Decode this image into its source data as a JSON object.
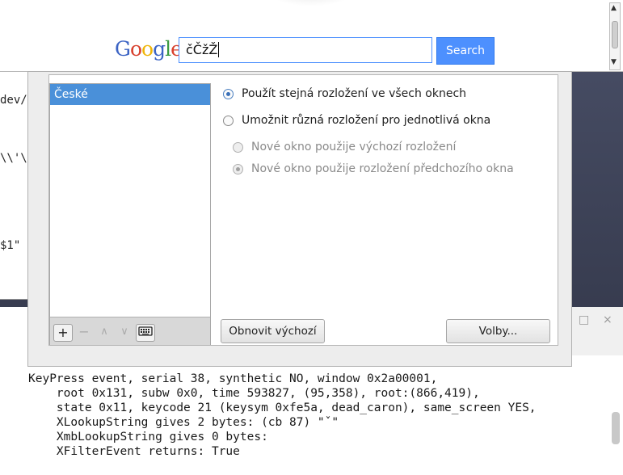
{
  "browser": {
    "logo_letters": [
      "G",
      "o",
      "o",
      "g",
      "l",
      "e"
    ],
    "search_value": "čČžŽ",
    "search_button": "Search"
  },
  "left_terminal": {
    "lines": [
      "dev/",
      "\\\\'\\",
      "$1\""
    ]
  },
  "dialog": {
    "layouts": [
      "České"
    ],
    "options": {
      "same_layout": "Použít stejná rozložení ve všech oknech",
      "different_layout": "Umožnit různá rozložení pro jednotlivá okna",
      "new_default": "Nové okno použije výchozí rozložení",
      "new_previous": "Nové okno použije rozložení předchozího okna"
    },
    "toolbar": {
      "add": "+",
      "remove": "−",
      "up": "∧",
      "down": "∨"
    },
    "reset_button": "Obnovit výchozí",
    "options_button": "Volby..."
  },
  "terminal": {
    "lines": [
      "KeyPress event, serial 38, synthetic NO, window 0x2a00001,",
      "    root 0x131, subw 0x0, time 593827, (95,358), root:(866,419),",
      "    state 0x11, keycode 21 (keysym 0xfe5a, dead_caron), same_screen YES,",
      "    XLookupString gives 2 bytes: (cb 87) \"ˇ\"",
      "    XmbLookupString gives 0 bytes:",
      "    XFilterEvent returns: True"
    ],
    "window_buttons": [
      "□",
      "×"
    ]
  }
}
